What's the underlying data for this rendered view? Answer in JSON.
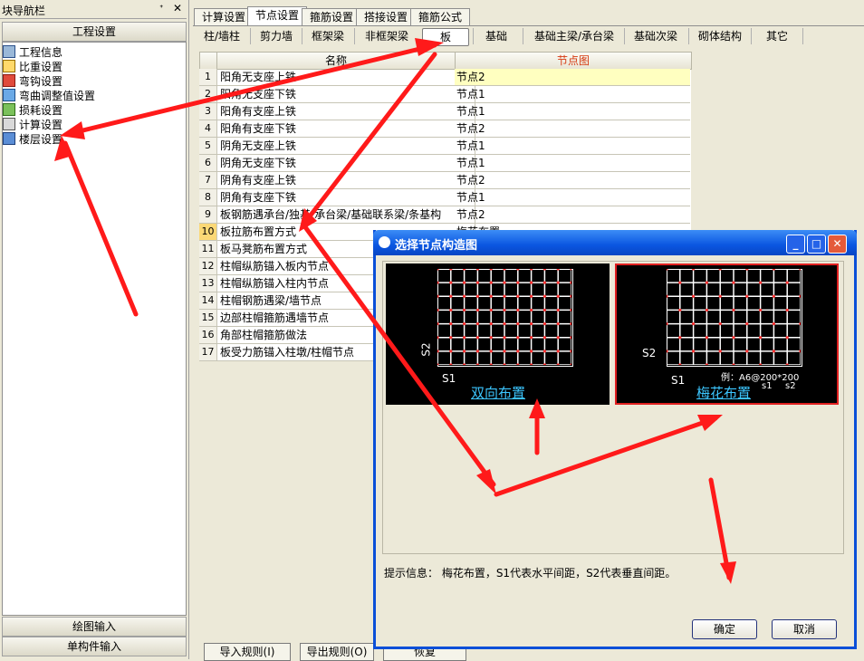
{
  "nav": {
    "title": "块导航栏",
    "pin": "ᐩ",
    "close": "✕",
    "section": "工程设置",
    "items": [
      "工程信息",
      "比重设置",
      "弯钩设置",
      "弯曲调整值设置",
      "损耗设置",
      "计算设置",
      "楼层设置"
    ],
    "btn1": "绘图输入",
    "btn2": "单构件输入"
  },
  "tabs": [
    "计算设置",
    "节点设置",
    "箍筋设置",
    "搭接设置",
    "箍筋公式"
  ],
  "subtabs": [
    "柱/墙柱",
    "剪力墙",
    "框架梁",
    "非框架梁",
    "板",
    "基础",
    "基础主梁/承台梁",
    "基础次梁",
    "砌体结构",
    "其它"
  ],
  "table": {
    "col_name": "名称",
    "col_val": "节点图",
    "rows": [
      {
        "n": "1",
        "name": "阳角无支座上铁",
        "val": "节点2"
      },
      {
        "n": "2",
        "name": "阳角无支座下铁",
        "val": "节点1"
      },
      {
        "n": "3",
        "name": "阳角有支座上铁",
        "val": "节点1"
      },
      {
        "n": "4",
        "name": "阳角有支座下铁",
        "val": "节点2"
      },
      {
        "n": "5",
        "name": "阴角无支座上铁",
        "val": "节点1"
      },
      {
        "n": "6",
        "name": "阴角无支座下铁",
        "val": "节点1"
      },
      {
        "n": "7",
        "name": "阴角有支座上铁",
        "val": "节点2"
      },
      {
        "n": "8",
        "name": "阴角有支座下铁",
        "val": "节点1"
      },
      {
        "n": "9",
        "name": "板钢筋遇承台/独基/承台梁/基础联系梁/条基构",
        "val": "节点2"
      },
      {
        "n": "10",
        "name": "板拉筋布置方式",
        "val": "梅花布置"
      },
      {
        "n": "11",
        "name": "板马凳筋布置方式",
        "val": ""
      },
      {
        "n": "12",
        "name": "柱帽纵筋锚入板内节点",
        "val": ""
      },
      {
        "n": "13",
        "name": "柱帽纵筋锚入柱内节点",
        "val": ""
      },
      {
        "n": "14",
        "name": "柱帽钢筋遇梁/墙节点",
        "val": ""
      },
      {
        "n": "15",
        "name": "边部柱帽箍筋遇墙节点",
        "val": ""
      },
      {
        "n": "16",
        "name": "角部柱帽箍筋做法",
        "val": ""
      },
      {
        "n": "17",
        "name": "板受力筋锚入柱墩/柱帽节点",
        "val": ""
      }
    ]
  },
  "bottom": {
    "import": "导入规则(I)",
    "export": "导出规则(O)",
    "restore": "恢复"
  },
  "dialog": {
    "title": "选择节点构造图",
    "min": "_",
    "max": "□",
    "close": "✕",
    "opt1": "双向布置",
    "opt2": "梅花布置",
    "s1": "S1",
    "s2": "S2",
    "example": "例：A6@200*200",
    "ex_s1": "s1",
    "ex_s2": "s2",
    "hint": "提示信息： 梅花布置，S1代表水平间距，S2代表垂直间距。",
    "ok": "确定",
    "cancel": "取消"
  }
}
